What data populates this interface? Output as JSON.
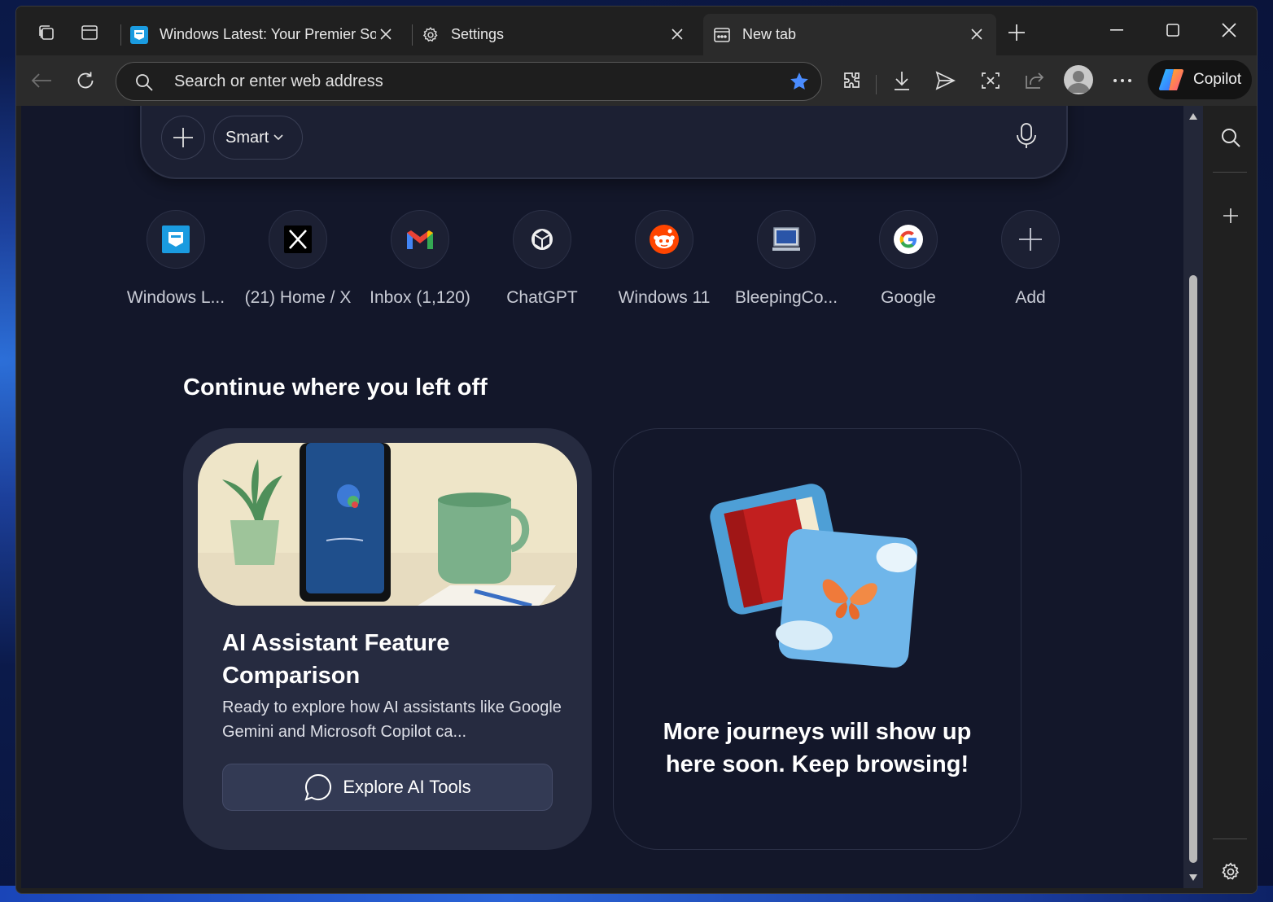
{
  "tabs": [
    {
      "title": "Windows Latest: Your Premier Sou",
      "favicon": "windows-latest-icon"
    },
    {
      "title": "Settings",
      "favicon": "gear-icon"
    },
    {
      "title": "New tab",
      "favicon": "new-tab-icon",
      "active": true
    }
  ],
  "address_bar": {
    "placeholder": "Search or enter web address"
  },
  "copilot": {
    "label": "Copilot"
  },
  "search_box": {
    "mode": "Smart"
  },
  "quick_links": [
    {
      "label": "Windows L...",
      "icon": "windows-latest-icon"
    },
    {
      "label": "(21) Home / X",
      "icon": "x-icon"
    },
    {
      "label": "Inbox (1,120)",
      "icon": "gmail-icon"
    },
    {
      "label": "ChatGPT",
      "icon": "chatgpt-icon"
    },
    {
      "label": "Windows 11",
      "icon": "reddit-icon"
    },
    {
      "label": "BleepingCo...",
      "icon": "bleepingcomputer-icon"
    },
    {
      "label": "Google",
      "icon": "google-icon"
    },
    {
      "label": "Add",
      "icon": "plus-icon"
    }
  ],
  "continue": {
    "heading": "Continue where you left off",
    "card1": {
      "title": "AI Assistant Feature Comparison",
      "description": "Ready to explore how AI assistants like Google Gemini and Microsoft Copilot ca...",
      "button": "Explore AI Tools"
    },
    "card2": {
      "text": "More journeys will show up here soon. Keep browsing!"
    }
  },
  "colors": {
    "page_bg": "#13172a",
    "card_bg": "#262b40",
    "star": "#4a8cff"
  }
}
